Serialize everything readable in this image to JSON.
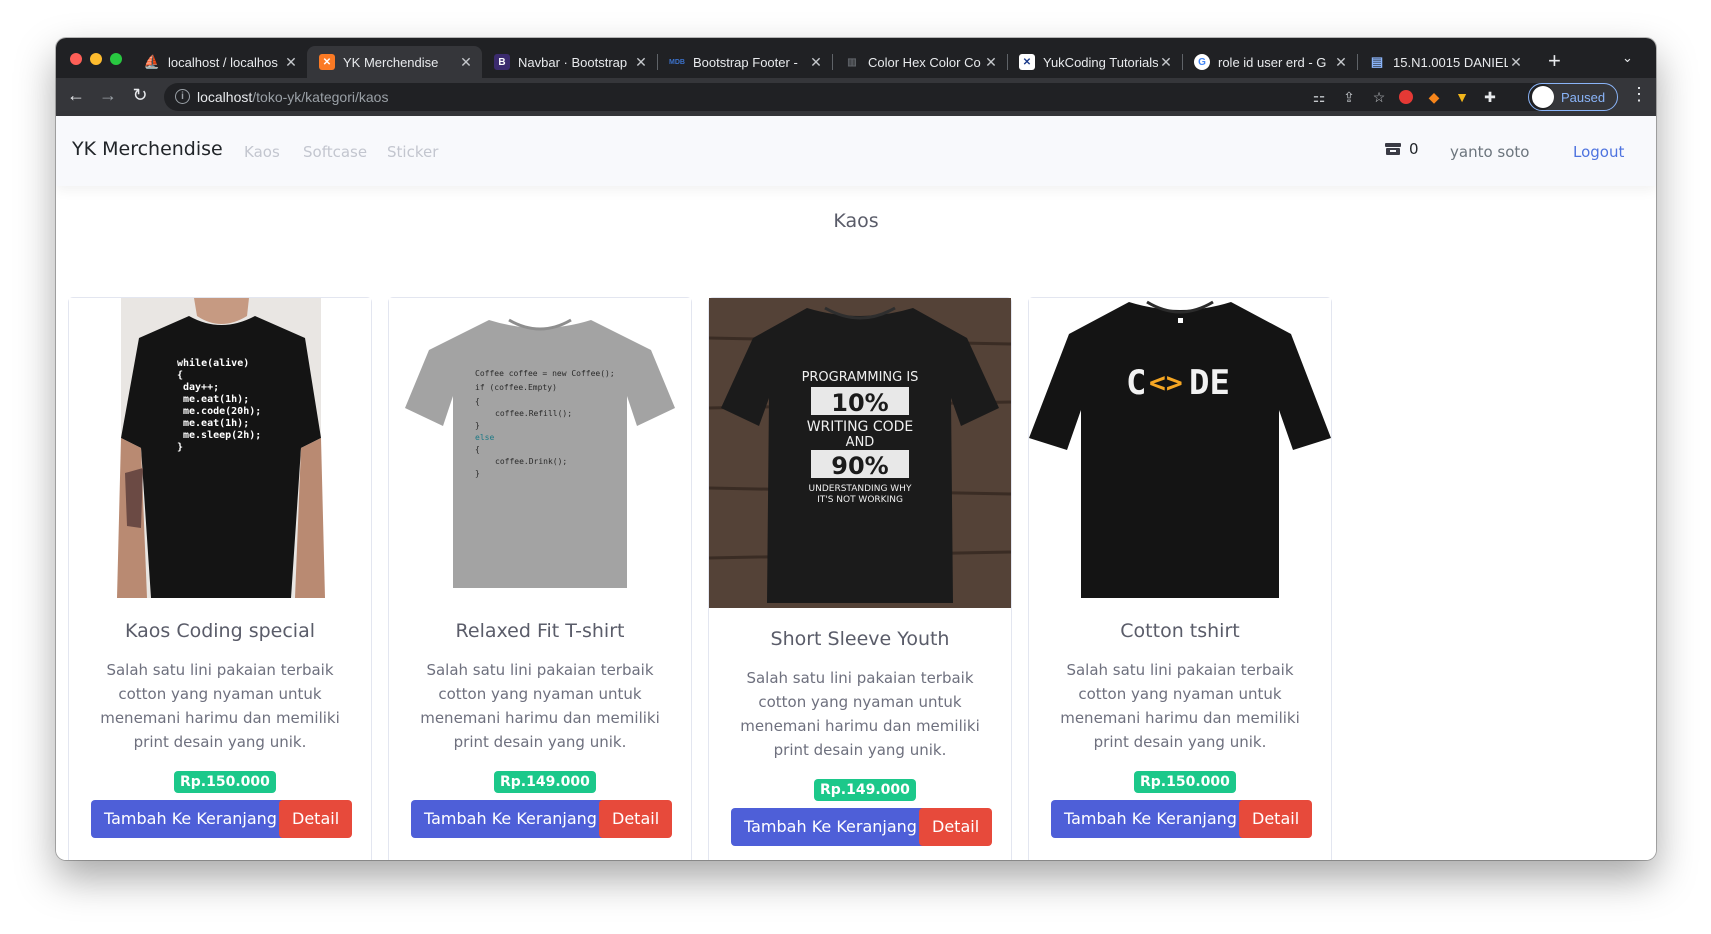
{
  "browser": {
    "tabs": [
      {
        "title": "localhost / localhos",
        "favicon": "phpmyadmin-icon",
        "active": false
      },
      {
        "title": "YK Merchendise",
        "favicon": "xampp-icon",
        "active": true
      },
      {
        "title": "Navbar · Bootstrap",
        "favicon": "bootstrap-icon",
        "active": false
      },
      {
        "title": "Bootstrap Footer - ",
        "favicon": "mdb-icon",
        "active": false
      },
      {
        "title": "Color Hex Color Co",
        "favicon": "colorhex-icon",
        "active": false
      },
      {
        "title": "YukCoding Tutorials",
        "favicon": "yukcoding-icon",
        "active": false
      },
      {
        "title": "role id user erd - G",
        "favicon": "google-icon",
        "active": false
      },
      {
        "title": "15.N1.0015 DANIEL",
        "favicon": "document-icon",
        "active": false
      }
    ],
    "url_host": "localhost",
    "url_path": "/toko-yk/kategori/kaos",
    "profile_label": "Paused"
  },
  "navbar": {
    "brand": "YK Merchendise",
    "links": [
      "Kaos",
      "Softcase",
      "Sticker"
    ],
    "cart_count": "0",
    "user_name": "yanto soto",
    "logout_label": "Logout"
  },
  "page_title": "Kaos",
  "products": [
    {
      "name": "Kaos Coding special",
      "description": "Salah satu lini pakaian terbaik cotton yang nyaman untuk menemani harimu dan memiliki print desain yang unik.",
      "price": "Rp.150.000",
      "add_label": "Tambah Ke Keranjang",
      "detail_label": "Detail",
      "print_lines": [
        "while(alive)",
        "{",
        "day++;",
        "me.eat(1h);",
        "me.code(20h);",
        "me.eat(1h);",
        "me.sleep(2h);",
        "}"
      ]
    },
    {
      "name": "Relaxed Fit T-shirt",
      "description": "Salah satu lini pakaian terbaik cotton yang nyaman untuk menemani harimu dan memiliki print desain yang unik.",
      "price": "Rp.149.000",
      "add_label": "Tambah Ke Keranjang",
      "detail_label": "Detail",
      "print_lines": [
        "Coffee coffee = new Coffee();",
        "if (coffee.Empty)",
        "{",
        "coffee.Refill();",
        "}",
        "else",
        "{",
        "coffee.Drink();",
        "}"
      ]
    },
    {
      "name": "Short Sleeve Youth",
      "description": "Salah satu lini pakaian terbaik cotton yang nyaman untuk menemani harimu dan memiliki print desain yang unik.",
      "price": "Rp.149.000",
      "add_label": "Tambah Ke Keranjang",
      "detail_label": "Detail",
      "print_lines": [
        "PROGRAMMING IS",
        "10%",
        "WRITING CODE",
        "AND",
        "90%",
        "UNDERSTANDING WHY",
        "IT'S NOT WORKING"
      ]
    },
    {
      "name": "Cotton tshirt",
      "description": "Salah satu lini pakaian terbaik cotton yang nyaman untuk menemani harimu dan memiliki print desain yang unik.",
      "price": "Rp.150.000",
      "add_label": "Tambah Ke Keranjang",
      "detail_label": "Detail",
      "print_lines": [
        "C",
        "<>",
        "DE"
      ]
    }
  ],
  "colors": {
    "primary": "#4e5fd8",
    "danger": "#e74a3b",
    "success": "#1cc88a",
    "navbar_bg": "#f8f9fc"
  }
}
